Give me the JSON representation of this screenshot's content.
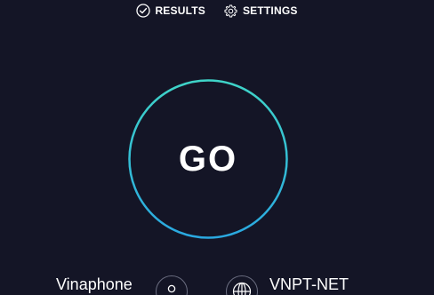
{
  "nav": {
    "results_label": "RESULTS",
    "settings_label": "SETTINGS",
    "results_icon": "check-circle-icon",
    "settings_icon": "gear-icon"
  },
  "go": {
    "label": "GO",
    "ring_color_start": "#3fd4c8",
    "ring_color_end": "#2aa8e0"
  },
  "connection": {
    "isp_name": "Vinaphone",
    "isp_icon": "user-icon",
    "server_name": "VNPT-NET",
    "server_icon": "globe-icon"
  },
  "colors": {
    "background": "#141526",
    "text": "#ffffff",
    "muted_outline": "#6a6d80"
  }
}
